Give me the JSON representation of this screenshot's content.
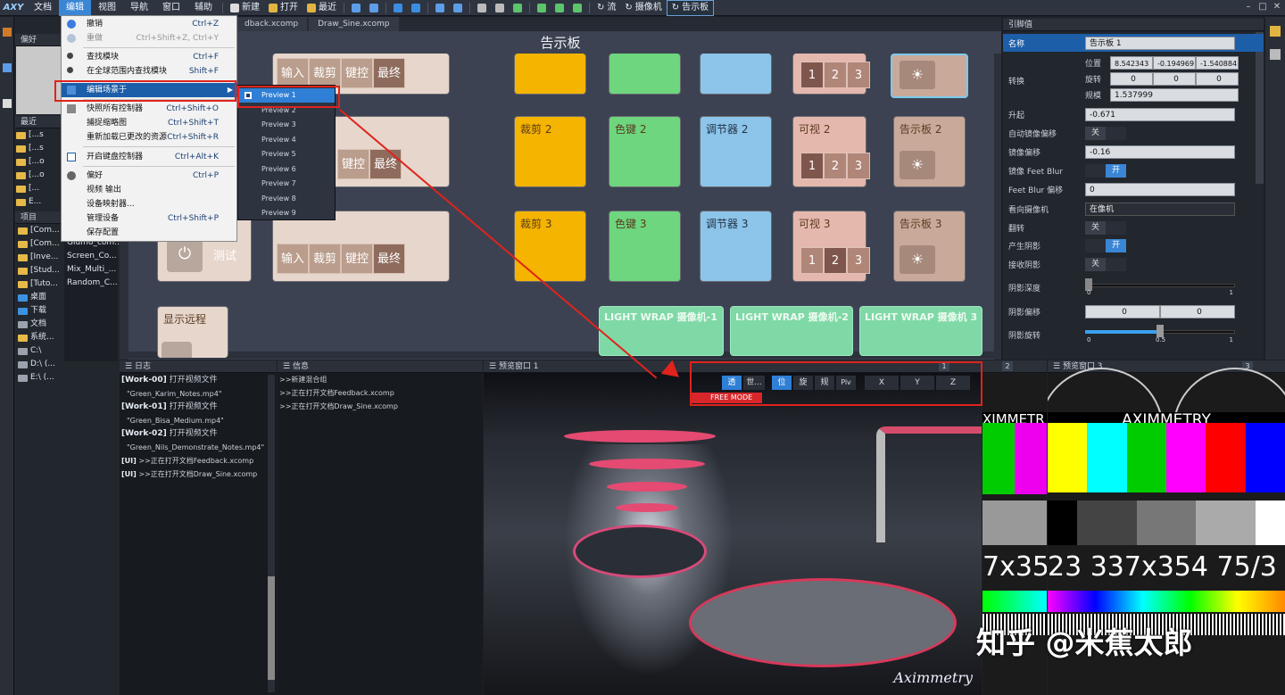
{
  "menubar": {
    "logo": "AXY",
    "items": [
      "文档",
      "编辑",
      "视图",
      "导航",
      "窗口",
      "辅助"
    ],
    "toolbar": [
      "新建",
      "打开",
      "最近",
      "流",
      "摄像机",
      "告示板"
    ]
  },
  "editmenu": {
    "items": [
      {
        "label": "撤销",
        "shortcut": "Ctrl+Z"
      },
      {
        "label": "重做",
        "shortcut": "Ctrl+Shift+Z, Ctrl+Y"
      },
      {
        "label": "查找模块",
        "shortcut": "Ctrl+F"
      },
      {
        "label": "在全球范围内查找模块",
        "shortcut": "Shift+F"
      },
      {
        "label": "编辑场景于",
        "shortcut": ""
      },
      {
        "label": "快照所有控制器",
        "shortcut": "Ctrl+Shift+O"
      },
      {
        "label": "捕捉缩略图",
        "shortcut": "Ctrl+Shift+T"
      },
      {
        "label": "重新加载已更改的资源",
        "shortcut": "Ctrl+Shift+R"
      },
      {
        "label": "开启键盘控制器",
        "shortcut": "Ctrl+Alt+K"
      },
      {
        "label": "偏好",
        "shortcut": "Ctrl+P"
      },
      {
        "label": "视频 输出",
        "shortcut": ""
      },
      {
        "label": "设备映射器...",
        "shortcut": ""
      },
      {
        "label": "管理设备",
        "shortcut": "Ctrl+Shift+P"
      },
      {
        "label": "保存配置",
        "shortcut": ""
      }
    ]
  },
  "submenu": [
    "Preview 1",
    "Preview 2",
    "Preview 3",
    "Preview 4",
    "Preview 5",
    "Preview 6",
    "Preview 7",
    "Preview 8",
    "Preview 9"
  ],
  "left": {
    "fav_title": "偏好",
    "recent_title": "最近",
    "recent_items": [
      "[...s",
      "[...s",
      "[...o",
      "[...o",
      "[...",
      "E..."
    ],
    "project_title": "项目",
    "project_items": [
      "[Com...",
      "[Com...",
      "[Inve...",
      "[Stud...",
      "[Tuto...",
      "桌面",
      "下载",
      "文档",
      "系统...",
      "C:\\",
      "D:\\ (...",
      "E:\\ (..."
    ],
    "doc_items": [
      "Glumo_com...",
      "Screen_Co...",
      "Mix_Multi_...",
      "Random_C..."
    ]
  },
  "editor": {
    "tabs": [
      "dback.xcomp",
      "Draw_Sine.xcomp"
    ],
    "board_title": "告示板",
    "row1_seg": [
      "输入",
      "裁剪",
      "键控",
      "最终"
    ],
    "row2_seg": [
      "键控",
      "最终"
    ],
    "row3_seg": [
      "输入",
      "裁剪",
      "键控",
      "最终"
    ],
    "crop2": "裁剪 2",
    "key2": "色键 2",
    "adj2": "调节器 2",
    "vis2": "可视 2",
    "board2": "告示板 2",
    "crop3": "裁剪 3",
    "key3": "色键 3",
    "adj3": "调节器 3",
    "vis3": "可视 3",
    "board3": "告示板 3",
    "nums": [
      "1",
      "2",
      "3"
    ],
    "test": "测试",
    "remote": "显示远程",
    "lightwrap": [
      "LIGHT WRAP 摄像机-1",
      "LIGHT WRAP 摄像机-2",
      "LIGHT WRAP 摄像机 3"
    ]
  },
  "props": {
    "title": "引脚值",
    "name_label": "名称",
    "name_val": "告示板 1",
    "transform_label": "转换",
    "pos_label": "位置",
    "pos": [
      "8.542343",
      "-0.194969",
      "-1.540884"
    ],
    "rot_label": "旋转",
    "rot": [
      "0",
      "0",
      "0"
    ],
    "scale_label": "规模",
    "scale": "1.537999",
    "rise_label": "升起",
    "rise": "-0.671",
    "automirror_label": "自动镜像偏移",
    "automirror": "关",
    "mirroroff_label": "镜像偏移",
    "mirroroff": "-0.16",
    "feetblur_label": "镜像 Feet Blur",
    "feetblur": "开",
    "feetbluroff_label": "Feet Blur 偏移",
    "feetbluroff": "0",
    "facecam_label": "看向摄像机",
    "facecam": "在像机",
    "flip_label": "翻转",
    "flip": "关",
    "castshadow_label": "产生阴影",
    "castshadow": "开",
    "recvshadow_label": "接收阴影",
    "recvshadow": "关",
    "shadowdepth_label": "阴影深度",
    "sd_min": "0",
    "sd_max": "1",
    "shadowoff_label": "阴影偏移",
    "so": [
      "0",
      "0"
    ],
    "shadowrot_label": "阴影旋转",
    "sr_min": "0",
    "sr_val": "0.5",
    "sr_max": "1"
  },
  "log": {
    "title": "日志",
    "lines": [
      {
        "tag": "[Work-00]",
        "text": " 打开视频文件"
      },
      {
        "tag": "",
        "text": "\"Green_Karim_Notes.mp4\""
      },
      {
        "tag": "[Work-01]",
        "text": " 打开视频文件"
      },
      {
        "tag": "",
        "text": "\"Green_Bisa_Medium.mp4\""
      },
      {
        "tag": "[Work-02]",
        "text": " 打开视频文件"
      },
      {
        "tag": "",
        "text": "\"Green_Nils_Demonstrate_Notes.mp4\""
      },
      {
        "tag": "[UI]",
        "text": " >>正在打开文档Feedback.xcomp"
      },
      {
        "tag": "[UI]",
        "text": " >>正在打开文档Draw_Sine.xcomp"
      }
    ]
  },
  "info": {
    "title": "信息",
    "lines": [
      ">>新建混合组",
      ">>正在打开文档Feedback.xcomp",
      ">>正在打开文档Draw_Sine.xcomp"
    ]
  },
  "preview1": {
    "title": "预览窗口 1",
    "num": "1",
    "buttons": [
      "透",
      "世...",
      "位",
      "旋",
      "规",
      "Piv",
      "X",
      "Y",
      "Z"
    ],
    "mode": "FREE MODE",
    "brand": "Aximmetry"
  },
  "preview2": {
    "num": "2"
  },
  "preview3": {
    "title": "预览窗口 3",
    "num": "3",
    "brand": "AXIMMETRY",
    "res_left": "7x352",
    "res": "23 337x354 75/3",
    "watermark": "知乎 @米蕉太郎"
  },
  "colors": {
    "accent": "#3a86d4",
    "red": "#e0231c",
    "orange": "#f5b400",
    "green": "#6dd67e",
    "blue": "#8cc4ea",
    "pink": "#e4b8ad",
    "tan": "#c9a99a",
    "lightwrap": "#7fd9a6"
  }
}
